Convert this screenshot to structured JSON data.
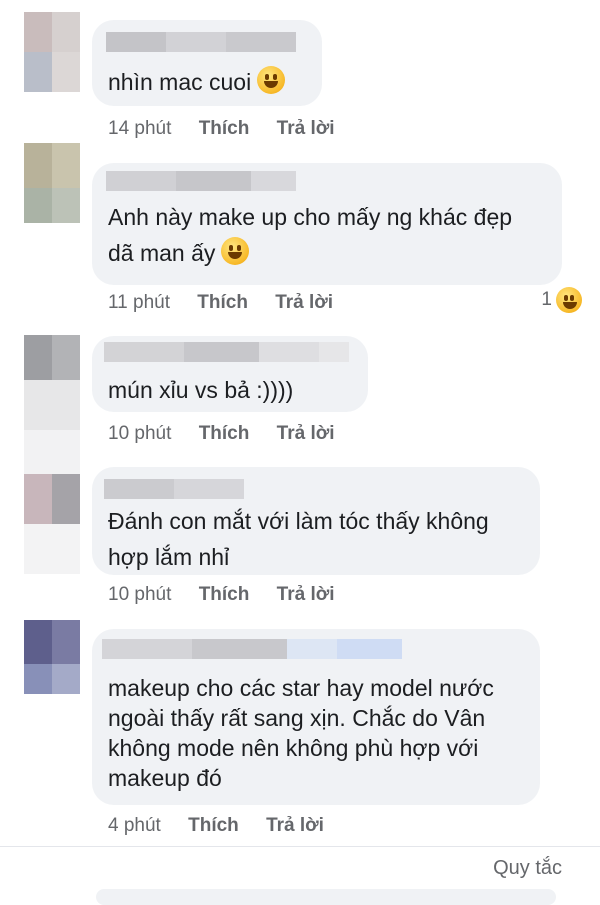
{
  "comments": [
    {
      "text_lines": [
        "nhìn mac cuoi"
      ],
      "emoji": "rolling-laughing-emoji",
      "time": "14 phút",
      "like": "Thích",
      "reply": "Trả lời"
    },
    {
      "text_lines": [
        "Anh này make up cho mấy ng khác đẹp",
        "dã man ấy"
      ],
      "emoji": "grinning-emoji",
      "time": "11 phút",
      "like": "Thích",
      "reply": "Trả lời",
      "reaction_count": "1",
      "reaction_emoji": "laughing-emoji"
    },
    {
      "text_lines": [
        "mún xỉu vs bả :))))"
      ],
      "time": "10 phút",
      "like": "Thích",
      "reply": "Trả lời"
    },
    {
      "text_lines": [
        "Đánh con mắt với làm tóc thấy không",
        "hợp lắm nhỉ"
      ],
      "time": "10 phút",
      "like": "Thích",
      "reply": "Trả lời"
    },
    {
      "text_lines": [
        "makeup cho các star hay model nước",
        "ngoài thấy rất sang xịn. Chắc do Vân",
        "không mode nên không phù hợp với",
        "makeup đó"
      ],
      "time": "4 phút",
      "like": "Thích",
      "reply": "Trả lời"
    }
  ],
  "footer": {
    "rules_link": "Quy tắc"
  },
  "colors": {
    "bubble": "#f0f2f5",
    "meta": "#65676b",
    "text": "#1c1e21"
  }
}
